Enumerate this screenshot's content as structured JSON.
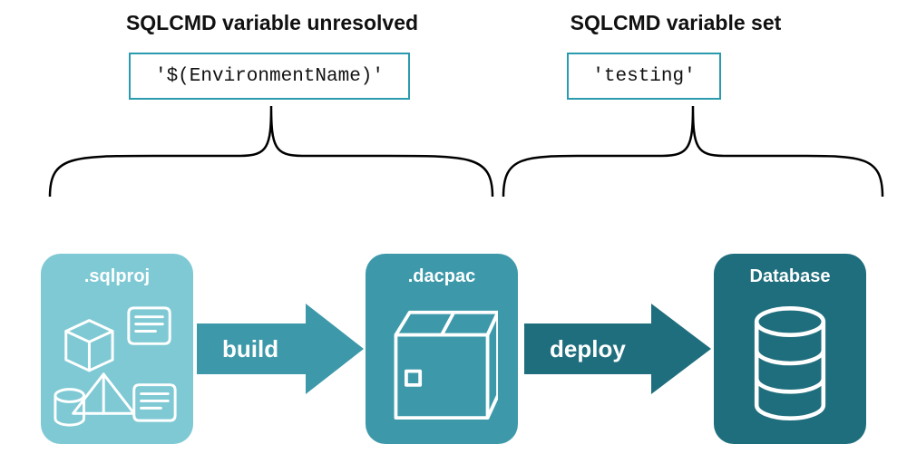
{
  "headings": {
    "left": "SQLCMD variable unresolved",
    "right": "SQLCMD variable set"
  },
  "codeboxes": {
    "left": "'$(EnvironmentName)'",
    "right": "'testing'"
  },
  "cards": {
    "sqlproj": {
      "title": ".sqlproj"
    },
    "dacpac": {
      "title": ".dacpac"
    },
    "database": {
      "title": "Database"
    }
  },
  "arrows": {
    "build": "build",
    "deploy": "deploy"
  },
  "colors": {
    "border_teal": "#2a9bae",
    "light_teal": "#7ec9d4",
    "mid_teal": "#3d99aa",
    "dark_teal": "#1f6e7d"
  }
}
